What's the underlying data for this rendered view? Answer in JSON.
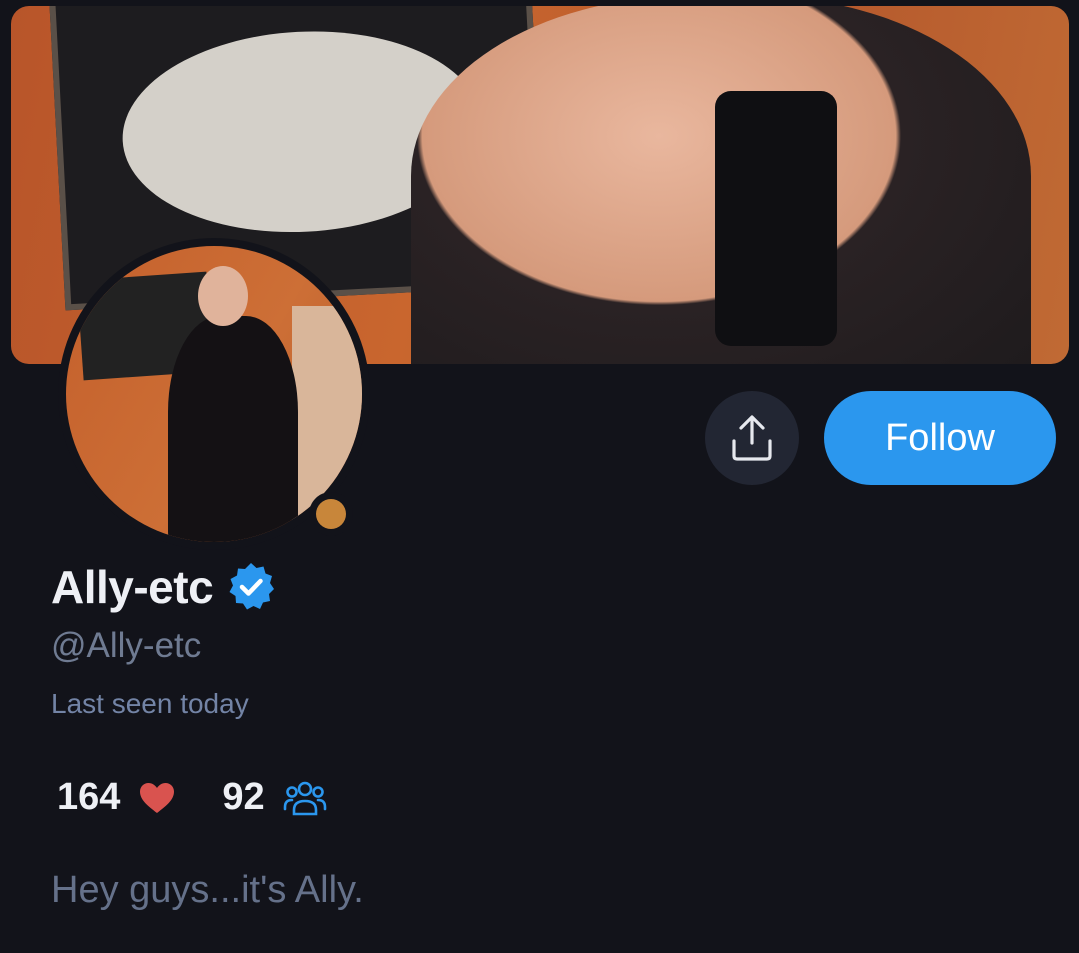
{
  "profile": {
    "display_name": "Ally-etc",
    "handle": "@Ally-etc",
    "last_seen": "Last seen today",
    "bio": "Hey guys...it's Ally.",
    "verified": true
  },
  "actions": {
    "follow_label": "Follow",
    "share_icon": "share-upload-icon"
  },
  "stats": {
    "likes": "164",
    "likes_icon": "heart-icon",
    "subscribers": "92",
    "subscribers_icon": "people-icon"
  },
  "colors": {
    "background": "#12131a",
    "accent": "#2b97ee",
    "heart": "#d9534f",
    "status_dot": "#c8863a"
  }
}
